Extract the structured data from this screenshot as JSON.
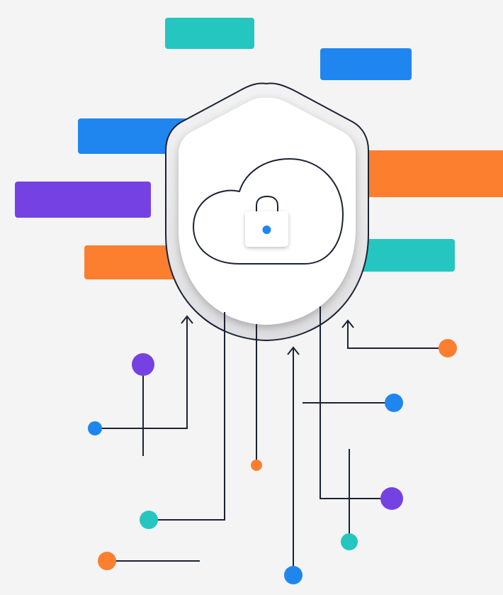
{
  "colors": {
    "background": "#f4f4f5",
    "teal": "#26c6c0",
    "blue": "#1f86f0",
    "orange": "#fb7f2f",
    "purple": "#7541e3",
    "line": "#1b2233",
    "shield_face": "#ffffff"
  },
  "illustration": {
    "subject": "cloud-security",
    "icons": [
      "shield-icon",
      "cloud-icon",
      "padlock-icon"
    ]
  }
}
